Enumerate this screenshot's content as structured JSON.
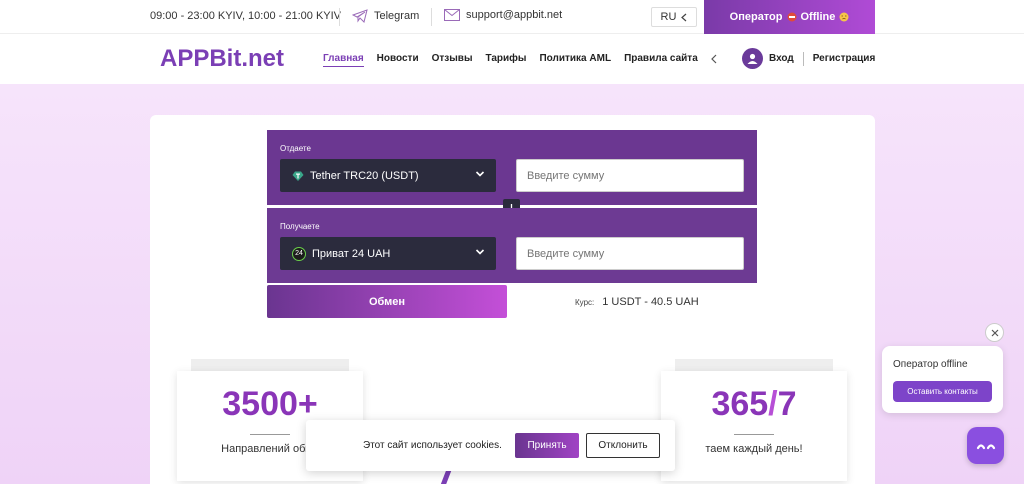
{
  "topbar": {
    "hours": "09:00 - 23:00 KYIV, 10:00 - 21:00 KYIV",
    "telegram": "Telegram",
    "email": "support@appbit.net",
    "lang": "RU",
    "operator_label": "Оператор",
    "operator_status": "Offline"
  },
  "nav": {
    "logo": "APPBit.net",
    "items": [
      "Главная",
      "Новости",
      "Отзывы",
      "Тарифы",
      "Политика AML",
      "Правила сайта"
    ],
    "login": "Вход",
    "register": "Регистрация"
  },
  "exchange": {
    "give_label": "Отдаете",
    "give_currency": "Tether TRC20 (USDT)",
    "give_placeholder": "Введите сумму",
    "get_label": "Получаете",
    "get_currency": "Приват 24 UAH",
    "get_badge": "24",
    "get_placeholder": "Введите сумму",
    "submit": "Обмен",
    "rate_label": "Курс:",
    "rate_value": "1 USDT - 40.5 UAH"
  },
  "stats": [
    {
      "num": "3500+",
      "text": "Направлений обме"
    },
    {
      "num_a": "365",
      "num_slash": "/",
      "num_b": "7",
      "text": "таем каждый день!"
    }
  ],
  "cookie": {
    "text": "Этот сайт использует cookies.",
    "accept": "Принять",
    "decline": "Отклонить"
  },
  "chat": {
    "status": "Оператор offline",
    "button": "Оставить контакты"
  },
  "colors": {
    "accent": "#7b3fb5",
    "panel": "#6b3791",
    "dark_select": "#2b2b3d"
  }
}
